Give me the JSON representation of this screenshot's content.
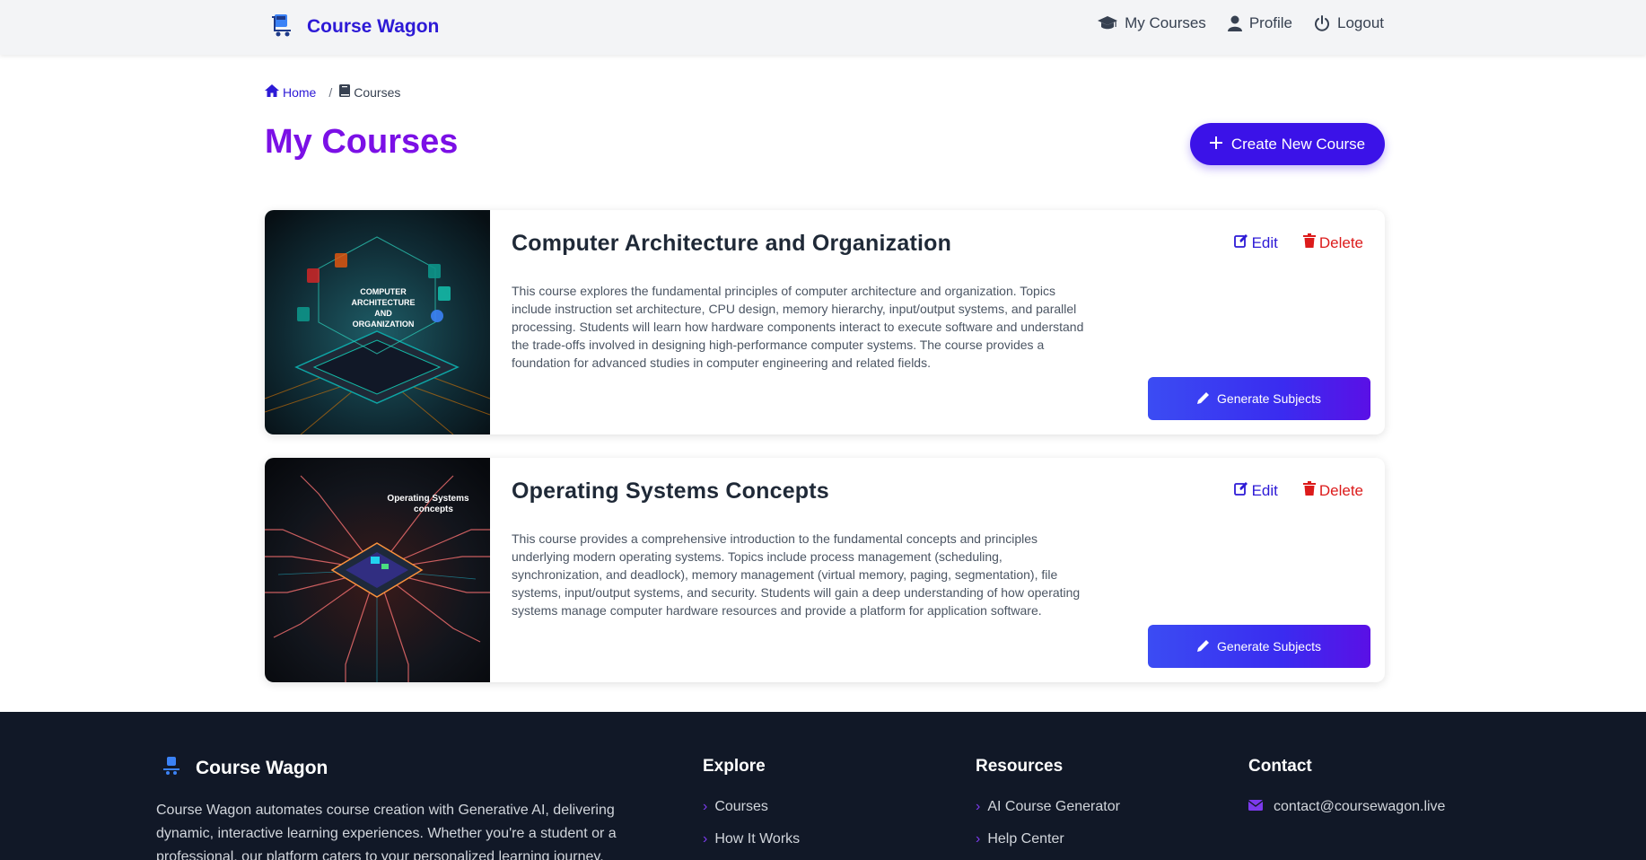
{
  "header": {
    "brand": "Course Wagon",
    "nav": [
      {
        "label": "My Courses",
        "icon": "graduation-cap-icon"
      },
      {
        "label": "Profile",
        "icon": "user-icon"
      },
      {
        "label": "Logout",
        "icon": "power-icon"
      }
    ]
  },
  "breadcrumb": {
    "home": "Home",
    "separator": "/",
    "current": "Courses"
  },
  "page": {
    "title": "My Courses",
    "create_button": "Create New Course"
  },
  "courses": [
    {
      "title": "Computer Architecture and Organization",
      "description": "This course explores the fundamental principles of computer architecture and organization. Topics include instruction set architecture, CPU design, memory hierarchy, input/output systems, and parallel processing. Students will learn how hardware components interact to execute software and understand the trade-offs involved in designing high-performance computer systems. The course provides a foundation for advanced studies in computer engineering and related fields.",
      "image_caption": [
        "COMPUTER",
        "ARCHITECTURE",
        "AND",
        "ORGANIZATION"
      ],
      "edit_label": "Edit",
      "delete_label": "Delete",
      "generate_label": "Generate Subjects"
    },
    {
      "title": "Operating Systems Concepts",
      "description": "This course provides a comprehensive introduction to the fundamental concepts and principles underlying modern operating systems. Topics include process management (scheduling, synchronization, and deadlock), memory management (virtual memory, paging, segmentation), file systems, input/output systems, and security. Students will gain a deep understanding of how operating systems manage computer hardware resources and provide a platform for application software.",
      "image_caption": [
        "Operating Systems",
        "concepts"
      ],
      "edit_label": "Edit",
      "delete_label": "Delete",
      "generate_label": "Generate Subjects"
    }
  ],
  "footer": {
    "brand": "Course Wagon",
    "description": "Course Wagon automates course creation with Generative AI, delivering dynamic, interactive learning experiences. Whether you're a student or a professional, our platform caters to your personalized learning journey.",
    "explore": {
      "heading": "Explore",
      "links": [
        "Courses",
        "How It Works"
      ]
    },
    "resources": {
      "heading": "Resources",
      "links": [
        "AI Course Generator",
        "Help Center"
      ]
    },
    "contact": {
      "heading": "Contact",
      "email": "contact@coursewagon.live"
    }
  },
  "colors": {
    "brand": "#2d1ad6",
    "title": "#7b10e6",
    "delete": "#dc1b1b",
    "footer_bg": "#111827"
  }
}
